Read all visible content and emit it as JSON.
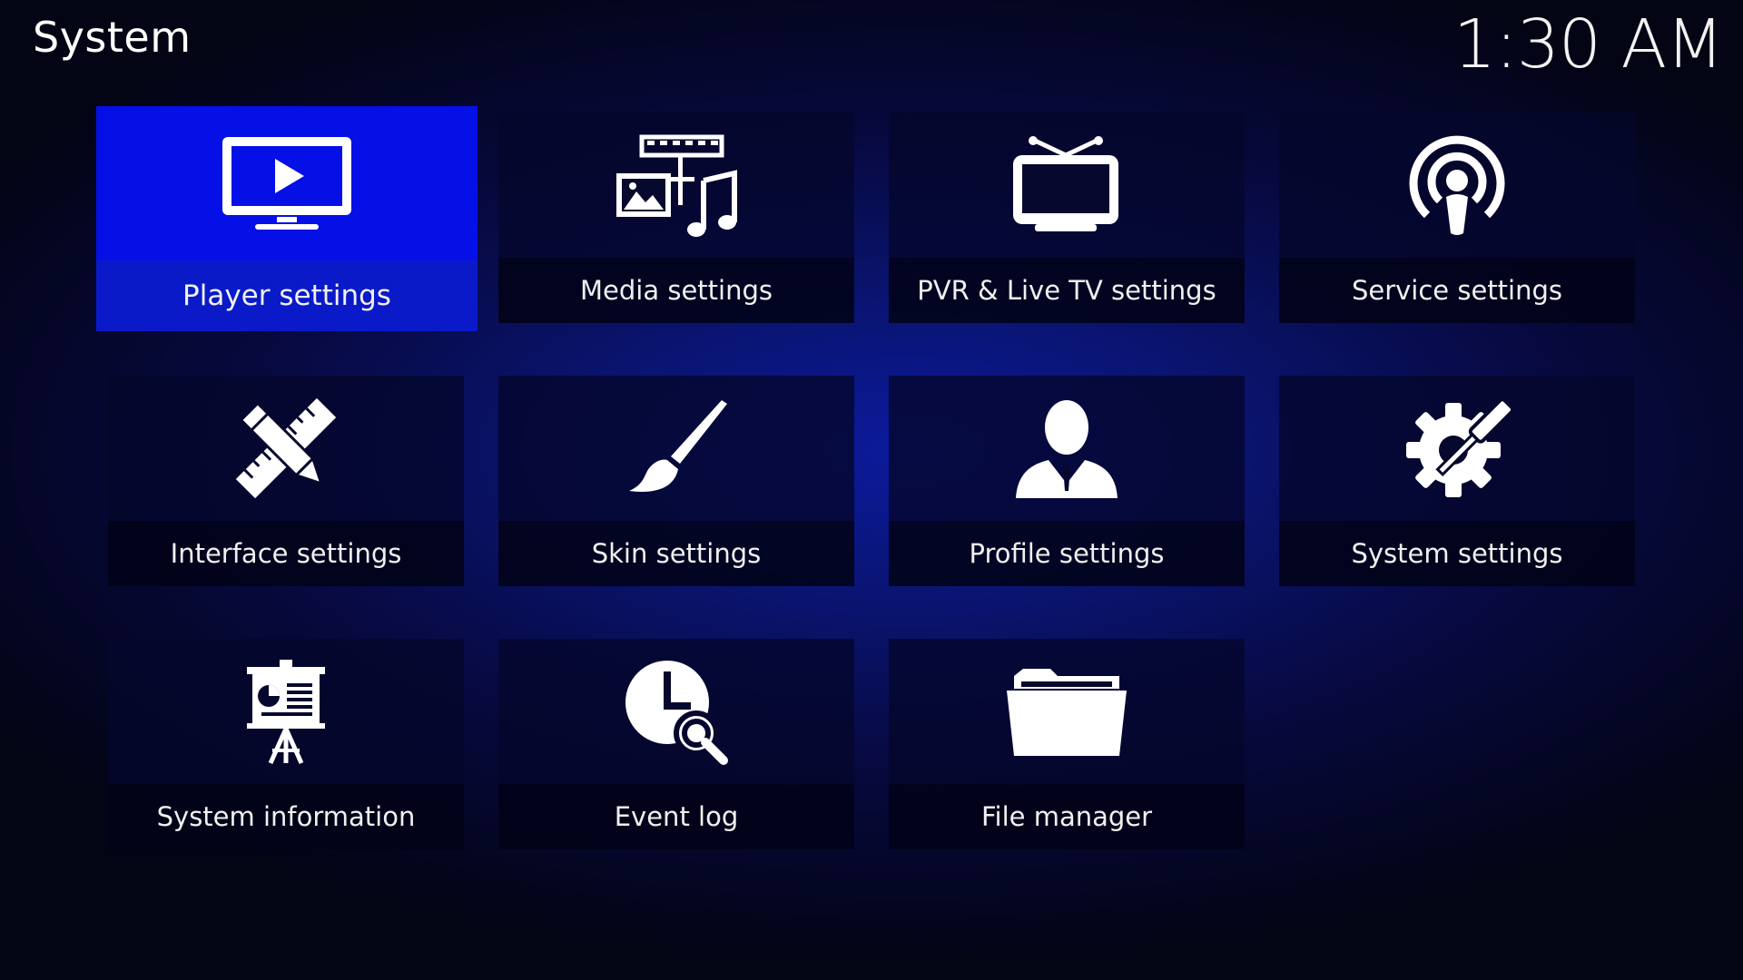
{
  "header": {
    "title": "System",
    "clock": "1:30 AM"
  },
  "tiles": [
    {
      "label": "Player settings",
      "icon": "tv-play-icon",
      "focused": true
    },
    {
      "label": "Media settings",
      "icon": "media-icon"
    },
    {
      "label": "PVR & Live TV settings",
      "icon": "tv-antenna-icon"
    },
    {
      "label": "Service settings",
      "icon": "broadcast-icon"
    },
    {
      "label": "Interface settings",
      "icon": "pencil-ruler-icon"
    },
    {
      "label": "Skin settings",
      "icon": "paintbrush-icon"
    },
    {
      "label": "Profile settings",
      "icon": "user-icon"
    },
    {
      "label": "System settings",
      "icon": "gear-screwdriver-icon"
    },
    {
      "label": "System information",
      "icon": "presentation-icon"
    },
    {
      "label": "Event log",
      "icon": "clock-search-icon"
    },
    {
      "label": "File manager",
      "icon": "folder-icon"
    }
  ],
  "colors": {
    "focus": "#0814d8",
    "background": "#07093f"
  }
}
